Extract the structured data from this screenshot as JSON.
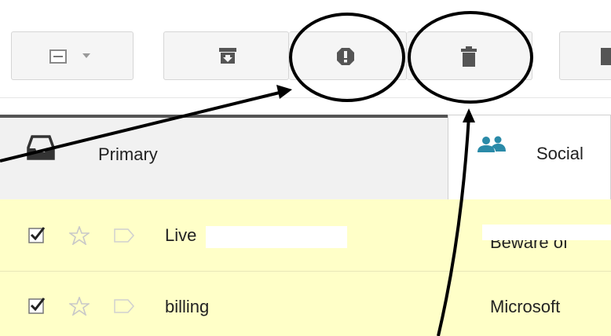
{
  "toolbar": {
    "buttons": [
      {
        "name": "select-all",
        "icon": "select-checkbox-icon"
      },
      {
        "name": "archive",
        "icon": "archive-icon"
      },
      {
        "name": "report-spam",
        "icon": "exclamation-icon"
      },
      {
        "name": "delete",
        "icon": "trash-icon"
      },
      {
        "name": "more",
        "icon": "folder-icon"
      }
    ]
  },
  "tabs": [
    {
      "label": "Primary",
      "icon": "inbox-icon"
    },
    {
      "label": "Social",
      "icon": "people-icon"
    }
  ],
  "emails": [
    {
      "sender": "Live",
      "subject": "Beware of",
      "checked": true,
      "starred": false
    },
    {
      "sender": "billing",
      "subject": "Microsoft",
      "checked": true,
      "starred": false
    }
  ],
  "colors": {
    "row_highlight": "#ffffc8",
    "tab_border": "#555555",
    "icon": "#555555",
    "annotation": "#000000"
  }
}
